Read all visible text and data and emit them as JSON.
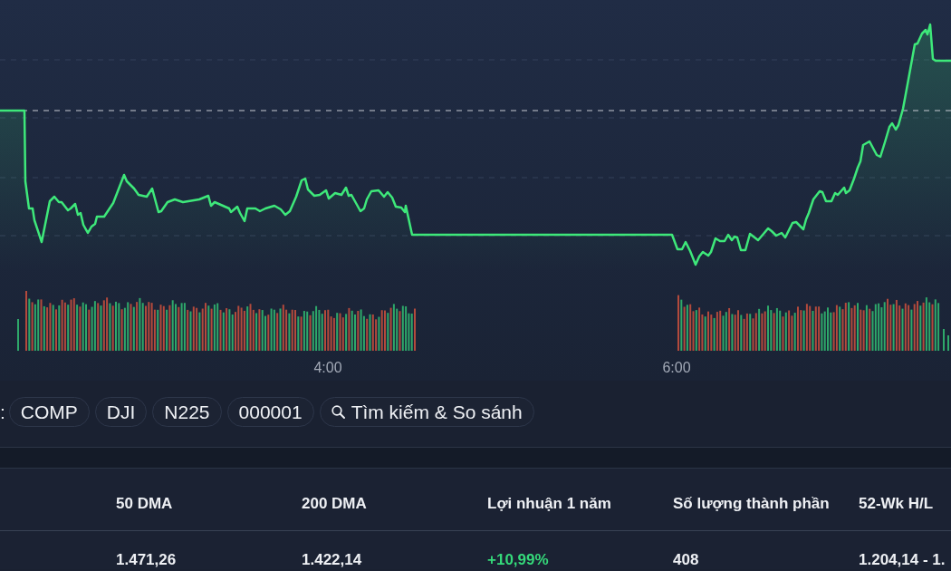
{
  "chart": {
    "time_labels": [
      "4:00",
      "6:00"
    ]
  },
  "compare_bar": {
    "label": ":",
    "indices": [
      {
        "label": "COMP"
      },
      {
        "label": "DJI"
      },
      {
        "label": "N225"
      },
      {
        "label": "000001"
      }
    ],
    "search_button": {
      "label": "Tìm kiếm & So sánh"
    }
  },
  "table": {
    "columns": [
      "50 DMA",
      "200 DMA",
      "Lợi nhuận 1 năm",
      "Số lượng thành phần",
      "52-Wk H/L"
    ],
    "rows": [
      {
        "cells": [
          {
            "text": "1.471,26",
            "color": "#eef0f4"
          },
          {
            "text": "1.422,14",
            "color": "#eef0f4"
          },
          {
            "text": "+10,99%",
            "color": "#35d97a"
          },
          {
            "text": "408",
            "color": "#eef0f4"
          },
          {
            "text": "1.204,14 - 1.",
            "color": "#eef0f4"
          }
        ]
      }
    ]
  }
}
